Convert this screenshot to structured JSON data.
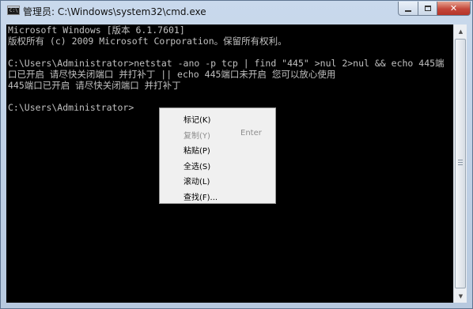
{
  "window": {
    "title": "管理员: C:\\Windows\\system32\\cmd.exe",
    "app_icon_glyph": "C:\\",
    "minimize_label": "",
    "maximize_label": "",
    "close_label": "✕"
  },
  "console": {
    "lines": [
      "Microsoft Windows [版本 6.1.7601]",
      "版权所有 (c) 2009 Microsoft Corporation。保留所有权利。",
      "",
      "C:\\Users\\Administrator>netstat -ano -p tcp | find \"445\" >nul 2>nul && echo 445端",
      "口已开启 请尽快关闭端口 并打补丁 || echo 445端口未开启 您可以放心使用",
      "445端口已开启 请尽快关闭端口 并打补丁",
      "",
      "C:\\Users\\Administrator>"
    ]
  },
  "scrollbar": {
    "up_arrow": "▲",
    "down_arrow": "▼"
  },
  "context_menu": {
    "items": [
      {
        "label": "标记(K)",
        "shortcut": "",
        "enabled": true
      },
      {
        "label": "复制(Y)",
        "shortcut": "Enter",
        "enabled": false
      },
      {
        "label": "粘贴(P)",
        "shortcut": "",
        "enabled": true
      },
      {
        "label": "全选(S)",
        "shortcut": "",
        "enabled": true
      },
      {
        "label": "滚动(L)",
        "shortcut": "",
        "enabled": true
      },
      {
        "label": "查找(F)...",
        "shortcut": "",
        "enabled": true
      }
    ]
  }
}
